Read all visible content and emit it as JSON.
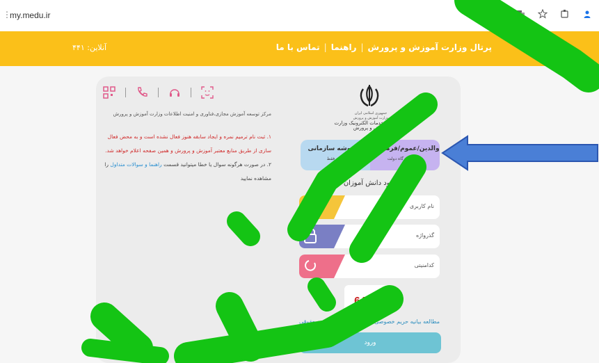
{
  "browser": {
    "url": "my.medu.ir"
  },
  "nav": {
    "portal_link": "پرتال وزارت آموزش و پرورش",
    "help_link": "راهنما",
    "contact_link": "تماس با ما",
    "online_label": "آنلاین:",
    "online_count": "۴۴۱"
  },
  "info": {
    "department": "مرکز توسعه آموزش مجازی،فناوری و امنیت اطلاعات وزارت آموزش و پرورش",
    "note1": "۱. ثبت نام ترمیم نمره و ایجاد سابقه هنوز فعال نشده است و به محض فعال سازی از طریق منابع معتبر آموزش و پرورش و همین صفحه اعلام خواهد شد.",
    "note2_prefix": "۲. در صورت هرگونه سوال یا خطا میتوانید قسمت",
    "note2_link": "راهنما و سوالات متداول",
    "note2_suffix": "را مشاهده نمایید"
  },
  "emblem": {
    "line1": "جمهوری اسلامی ایران",
    "line2": "وزارت آموزش و پرورش",
    "line3": "پنجره واحد خدمات الکترونیک وزارت آموزش و پرورش"
  },
  "tabs": [
    {
      "title": "والدین/عموم/فرهنگیان",
      "subtitle": "ورود از درگاه دولت"
    },
    {
      "title": "کارتوشه سازمانی",
      "subtitle": "ورود فقط"
    }
  ],
  "login": {
    "section_title": "ورود دانش آموزان",
    "username_label": "نام کاربری",
    "password_label": "گذرواژه",
    "captcha_label": "کدامنیتی",
    "captcha_code": "64588",
    "privacy_link": "مطالعه بیانیه حریم خصوصی",
    "legal_link": "ورود حقوقی",
    "submit_label": "ورود"
  },
  "colors": {
    "nav": "#fbc019",
    "tab_primary": "#c6b3f0",
    "tab_secondary": "#b8d9f0",
    "button": "#6ec4d4",
    "overlay": "#16c416"
  }
}
